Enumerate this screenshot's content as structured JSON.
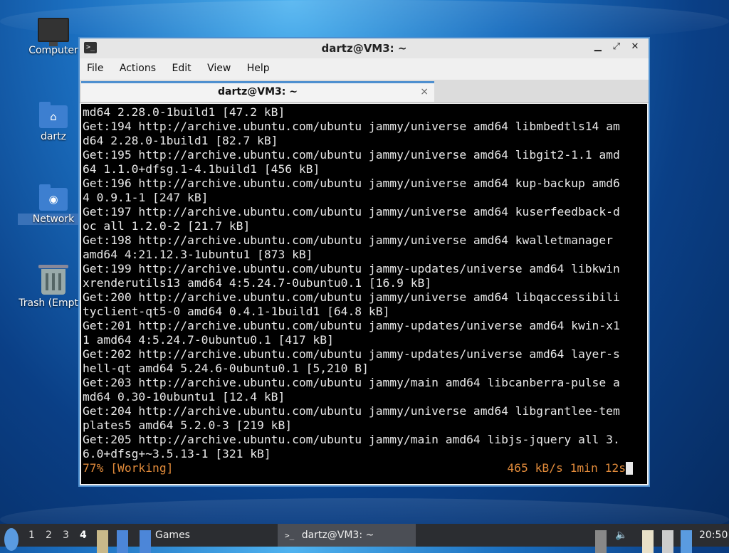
{
  "desktop": {
    "icons": [
      {
        "label": "Computer"
      },
      {
        "label": "dartz"
      },
      {
        "label": "Network"
      },
      {
        "label": "Trash (Empty)"
      }
    ]
  },
  "window": {
    "title": "dartz@VM3: ~",
    "menu": [
      "File",
      "Actions",
      "Edit",
      "View",
      "Help"
    ],
    "tab_label": "dartz@VM3: ~",
    "tab_close": "×",
    "controls": {
      "minimize": "▁",
      "maximize": "⤢",
      "close": "✕"
    }
  },
  "terminal": {
    "lines": [
      "md64 2.28.0-1build1 [47.2 kB]",
      "Get:194 http://archive.ubuntu.com/ubuntu jammy/universe amd64 libmbedtls14 am",
      "d64 2.28.0-1build1 [82.7 kB]",
      "Get:195 http://archive.ubuntu.com/ubuntu jammy/universe amd64 libgit2-1.1 amd",
      "64 1.1.0+dfsg.1-4.1build1 [456 kB]",
      "Get:196 http://archive.ubuntu.com/ubuntu jammy/universe amd64 kup-backup amd6",
      "4 0.9.1-1 [247 kB]",
      "Get:197 http://archive.ubuntu.com/ubuntu jammy/universe amd64 kuserfeedback-d",
      "oc all 1.2.0-2 [21.7 kB]",
      "Get:198 http://archive.ubuntu.com/ubuntu jammy/universe amd64 kwalletmanager",
      "amd64 4:21.12.3-1ubuntu1 [873 kB]",
      "Get:199 http://archive.ubuntu.com/ubuntu jammy-updates/universe amd64 libkwin",
      "xrenderutils13 amd64 4:5.24.7-0ubuntu0.1 [16.9 kB]",
      "Get:200 http://archive.ubuntu.com/ubuntu jammy/universe amd64 libqaccessibili",
      "tyclient-qt5-0 amd64 0.4.1-1build1 [64.8 kB]",
      "Get:201 http://archive.ubuntu.com/ubuntu jammy-updates/universe amd64 kwin-x1",
      "1 amd64 4:5.24.7-0ubuntu0.1 [417 kB]",
      "Get:202 http://archive.ubuntu.com/ubuntu jammy-updates/universe amd64 layer-s",
      "hell-qt amd64 5.24.6-0ubuntu0.1 [5,210 B]",
      "Get:203 http://archive.ubuntu.com/ubuntu jammy/main amd64 libcanberra-pulse a",
      "md64 0.30-10ubuntu1 [12.4 kB]",
      "Get:204 http://archive.ubuntu.com/ubuntu jammy/universe amd64 libgrantlee-tem",
      "plates5 amd64 5.2.0-3 [219 kB]",
      "Get:205 http://archive.ubuntu.com/ubuntu jammy/main amd64 libjs-jquery all 3.",
      "6.0+dfsg+~3.5.13-1 [321 kB]"
    ],
    "status_left": "77% [Working]",
    "status_right": "465 kB/s 1min 12s"
  },
  "taskbar": {
    "workspaces": [
      "1",
      "2",
      "3",
      "4"
    ],
    "active_workspace": "4",
    "launcher_label": "Games",
    "task_label": "dartz@VM3: ~",
    "clock": "20:50"
  },
  "colors": {
    "accent": "#4e8fcf",
    "status_text": "#e08a3a",
    "terminal_bg": "#000000"
  }
}
